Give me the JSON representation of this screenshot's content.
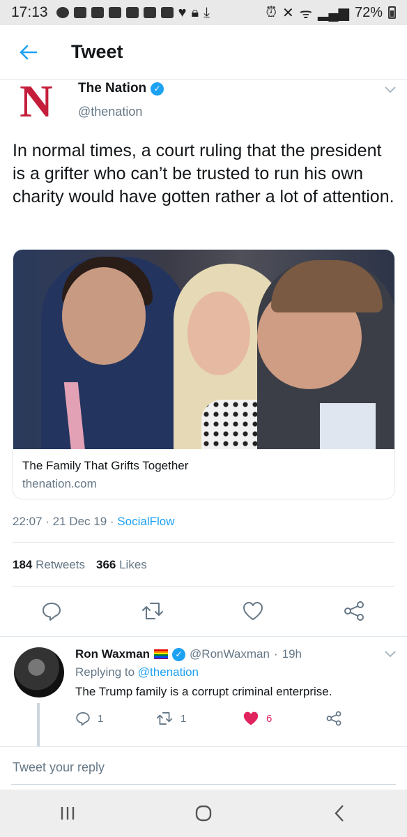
{
  "status_bar": {
    "time": "17:13",
    "battery": "72%"
  },
  "header": {
    "title": "Tweet"
  },
  "tweet": {
    "author_name": "The Nation",
    "author_handle": "@thenation",
    "logo_letter": "N",
    "text": "In normal times, a court ruling that the president is a grifter who can’t be trusted to run his own charity would have gotten rather a lot of attention.",
    "card": {
      "title": "The Family That Grifts Together",
      "domain": "thenation.com"
    },
    "time": "22:07",
    "date": "21 Dec 19",
    "source": "SocialFlow",
    "retweets_count": "184",
    "retweets_label": "Retweets",
    "likes_count": "366",
    "likes_label": "Likes"
  },
  "reply": {
    "author_name": "Ron Waxman",
    "author_handle": "@RonWaxman",
    "age": "19h",
    "replying_prefix": "Replying to",
    "replying_to": "@thenation",
    "text": "The Trump family is a corrupt criminal enterprise.",
    "reply_count": "1",
    "retweet_count": "1",
    "like_count": "6"
  },
  "composer": {
    "placeholder": "Tweet your reply"
  },
  "colors": {
    "accent": "#1da1f2",
    "like": "#e0245e",
    "nation_red": "#c41e3a"
  }
}
